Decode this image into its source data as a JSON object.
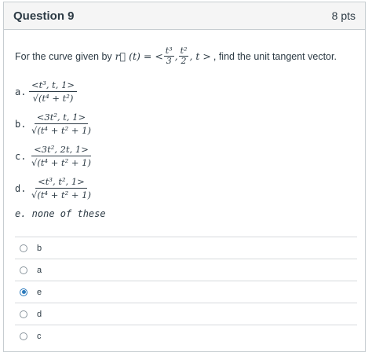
{
  "question": {
    "title": "Question 9",
    "points": "8 pts",
    "prompt_prefix": "For the curve given by",
    "prompt_func": "r⃗ (t) = <",
    "prompt_f1_num": "t³",
    "prompt_f1_den": "3",
    "prompt_f2_num": "t²",
    "prompt_f2_den": "2",
    "prompt_tail": ", t >",
    "prompt_suffix": ", find the unit tangent vector."
  },
  "choices": [
    {
      "label": "a.",
      "num": "<t³, t, 1>",
      "den": "√(t⁴ + t²)"
    },
    {
      "label": "b.",
      "num": "<3t², t, 1>",
      "den": "√(t⁴ + t² + 1)"
    },
    {
      "label": "c.",
      "num": "<3t², 2t, 1>",
      "den": "√(t⁴ + t² + 1)"
    },
    {
      "label": "d.",
      "num": "<t³, t², 1>",
      "den": "√(t⁴ + t² + 1)"
    }
  ],
  "choice_e": "e. none of these",
  "answers": [
    {
      "text": "b",
      "selected": false
    },
    {
      "text": "a",
      "selected": false
    },
    {
      "text": "e",
      "selected": true
    },
    {
      "text": "d",
      "selected": false
    },
    {
      "text": "c",
      "selected": false
    }
  ],
  "colors": {
    "accent": "#2b7abc",
    "header_bg": "#f5f5f5",
    "border": "#c7cdd1"
  }
}
